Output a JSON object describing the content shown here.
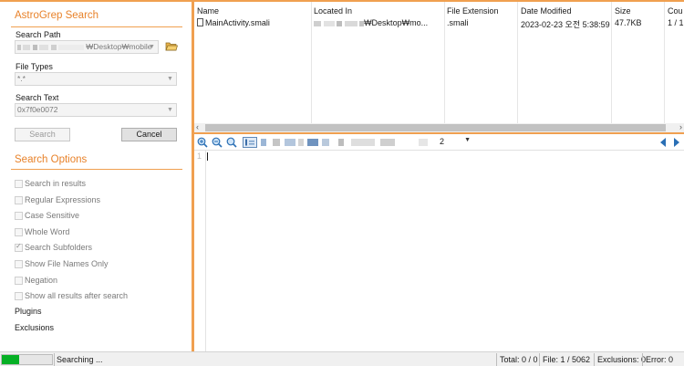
{
  "app": {
    "title": "AstroGrep Search"
  },
  "search": {
    "path_label": "Search Path",
    "path_value": "₩Desktop₩mobile",
    "types_label": "File Types",
    "types_value": "*.*",
    "text_label": "Search Text",
    "text_value": "0x7f0e0072",
    "search_button": "Search",
    "cancel_button": "Cancel"
  },
  "options": {
    "title": "Search Options",
    "items": [
      {
        "label": "Search in results",
        "checked": false
      },
      {
        "label": "Regular Expressions",
        "checked": false
      },
      {
        "label": "Case Sensitive",
        "checked": false
      },
      {
        "label": "Whole Word",
        "checked": false
      },
      {
        "label": "Search Subfolders",
        "checked": true
      },
      {
        "label": "Show File Names Only",
        "checked": false
      },
      {
        "label": "Negation",
        "checked": false
      },
      {
        "label": "Show all results after search",
        "checked": false
      }
    ],
    "plugins": "Plugins",
    "exclusions": "Exclusions"
  },
  "results": {
    "columns": [
      "Name",
      "Located In",
      "File Extension",
      "Date Modified",
      "Size",
      "Cou"
    ],
    "rows": [
      {
        "name": "MainActivity.smali",
        "located_in": "₩Desktop₩mo...",
        "extension": ".smali",
        "modified": "2023-02-23 오전 5:38:59",
        "size": "47.7KB",
        "count": "1 / 1"
      }
    ]
  },
  "preview": {
    "font_size_value": "2",
    "line_number": "1"
  },
  "status": {
    "progress": 0.35,
    "progress_color": "#06b025",
    "text": "Searching ...",
    "total": "Total: 0 / 0",
    "file": "File: 1 / 5062",
    "exclusions": "Exclusions: 0",
    "error": "Error: 0"
  },
  "colors": {
    "accent": "#f0a050",
    "title": "#e8822a"
  }
}
